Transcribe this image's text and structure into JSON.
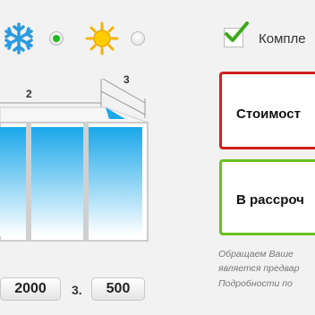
{
  "climate": {
    "cold_icon": "snowflake-icon",
    "warm_icon": "sun-icon",
    "cold_selected": true,
    "warm_selected": false
  },
  "option": {
    "checked": true,
    "label": "Компле"
  },
  "dimensions": {
    "label_2": "2",
    "label_3": "3"
  },
  "price_box": {
    "text": "Стоимост",
    "border_color": "#d31f1f"
  },
  "installment_box": {
    "text": "В рассроч",
    "border_color": "#6cbf1f"
  },
  "note": {
    "line1": "Обращаем Ваше",
    "line2": "является предвар",
    "line3": "Подробности по"
  },
  "inputs": {
    "field2_value": "2000",
    "field3_label": "3.",
    "field3_value": "500"
  },
  "colors": {
    "radio_active": "#22bb22",
    "glass_top": "#1aa7ea",
    "glass_bottom": "#ffffff"
  }
}
